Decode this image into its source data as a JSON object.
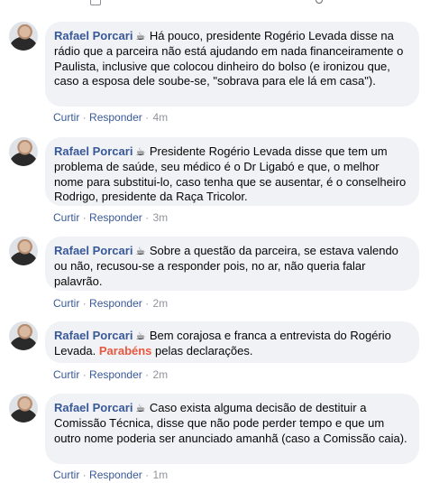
{
  "comments": [
    {
      "author": "Rafael Porcari",
      "text": "Há pouco, presidente Rogério Levada disse na rádio que a parceira não está ajudando em nada financeiramente o Paulista, inclusive que colocou dinheiro do bolso (e ironizou que, caso a esposa dele soube-se, \"sobrava para ele lá em casa\").",
      "time": "4m"
    },
    {
      "author": "Rafael Porcari",
      "text": "Presidente Rogério Levada disse que tem um problema de saúde, seu médico é o Dr Ligabó e que, o melhor nome para substitui-lo, caso tenha que se ausentar, é o conselheiro Rodrigo, presidente da Raça Tricolor.",
      "time": "3m"
    },
    {
      "author": "Rafael Porcari",
      "text": "Sobre a questão da parceira, se estava valendo ou não, recusou-se a responder pois, no ar, não queria falar palavrão.",
      "time": "2m"
    },
    {
      "author": "Rafael Porcari",
      "text_before": "Bem corajosa e franca a entrevista do Rogério Levada. ",
      "text_highlight": "Parabéns",
      "text_after": " pelas declarações.",
      "time": "2m"
    },
    {
      "author": "Rafael Porcari",
      "text": "Caso exista alguma decisão de destituir a Comissão Técnica, disse que não pode perder tempo e que um outro nome poderia ser anunciado amanhã (caso a Comissão caia).",
      "time": "1m"
    }
  ],
  "actions": {
    "like": "Curtir",
    "separator": "·",
    "reply": "Responder"
  },
  "icons": {
    "author_badge": "coffee-cup-icon"
  },
  "colors": {
    "author": "#385898",
    "bubble": "#f0f2f5",
    "highlight": "#e9573f"
  }
}
